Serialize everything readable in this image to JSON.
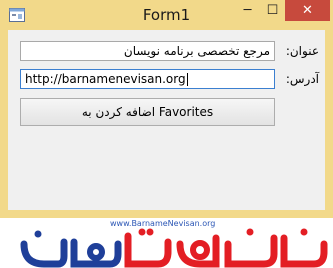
{
  "window": {
    "title": "Form1",
    "buttons": {
      "minimize": "─",
      "maximize": "☐",
      "close": "✕"
    }
  },
  "form": {
    "title_label": "عنوان:",
    "title_value": "مرجع تخصصی برنامه نویسان",
    "address_label": "آدرس:",
    "address_value": "http://barnamenevisan.org",
    "add_button_label": "اضافه کردن به Favorites"
  },
  "logo": {
    "url_text": "www.BarnameNevisan.org",
    "wordmark": "برنامه نویسان",
    "colors": {
      "red": "#e31e24",
      "blue": "#1f3f99"
    }
  },
  "colors": {
    "title_bar": "#f2d98a",
    "close_button": "#c74a3d",
    "focus_border": "#3b7fd0"
  }
}
